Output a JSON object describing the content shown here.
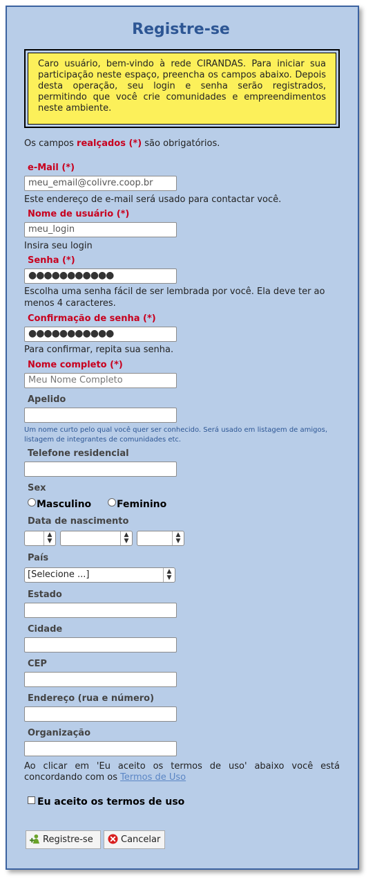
{
  "page": {
    "title": "Registre-se",
    "welcome": "Caro usuário, bem-vindo à rede CIRANDAS. Para iniciar sua participação neste espaço, preencha os campos abaixo. Depois desta operação, seu login e senha serão registrados, permitindo que você crie comunidades e empreendimentos neste ambiente.",
    "required_note": {
      "before": "Os campos ",
      "highlight": "realçados (*)",
      "after": " são obrigatórios."
    }
  },
  "fields": {
    "email": {
      "label": "e-Mail (*)",
      "value": "meu_email@colivre.coop.br",
      "help": "Este endereço de e-mail será usado para contactar você."
    },
    "login": {
      "label": "Nome de usuário (*)",
      "value": "meu_login",
      "help": "Insira seu login"
    },
    "password": {
      "label": "Senha (*)",
      "value": "●●●●●●●●●●●",
      "help": "Escolha uma senha fácil de ser lembrada por você. Ela deve ter ao menos 4 caracteres."
    },
    "password_confirm": {
      "label": "Confirmação de senha (*)",
      "value": "●●●●●●●●●●●",
      "help": "Para confirmar, repita sua senha."
    },
    "full_name": {
      "label": "Nome completo (*)",
      "placeholder": "Meu Nome Completo"
    },
    "nickname": {
      "label": "Apelido",
      "help": "Um nome curto pelo qual você quer ser conhecido. Será usado em listagem de amigos, listagem de integrantes de comunidades etc."
    },
    "home_phone": {
      "label": "Telefone residencial"
    },
    "sex": {
      "label": "Sex",
      "options": [
        "Masculino",
        "Feminino"
      ]
    },
    "birth_date": {
      "label": "Data de nascimento"
    },
    "country": {
      "label": "País",
      "selected": "[Selecione ...]"
    },
    "state": {
      "label": "Estado"
    },
    "city": {
      "label": "Cidade"
    },
    "zip": {
      "label": "CEP"
    },
    "address": {
      "label": "Endereço (rua e número)"
    },
    "organization": {
      "label": "Organização"
    }
  },
  "terms": {
    "text": "Ao clicar em 'Eu aceito os termos de uso' abaixo você está concordando com os ",
    "link": "Termos de Uso",
    "checkbox_label": "Eu aceito os termos de uso"
  },
  "buttons": {
    "register": "Registre-se",
    "cancel": "Cancelar"
  },
  "colors": {
    "panel_bg": "#b8cde8",
    "title": "#2d5694",
    "required": "#c8001e",
    "welcome_bg": "#fcf05a",
    "link": "#5b86c5"
  }
}
